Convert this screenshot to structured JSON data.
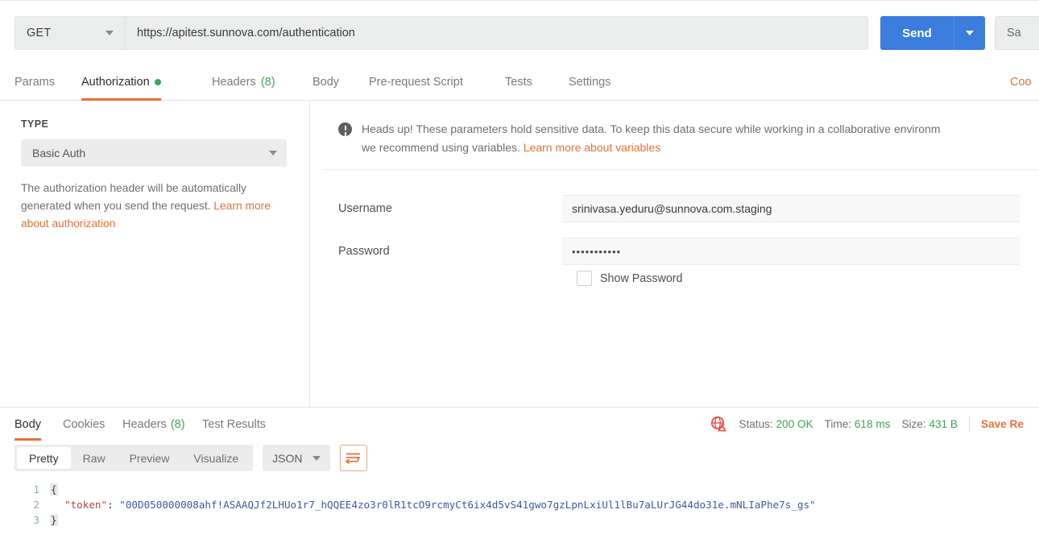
{
  "url_bar": {
    "method": "GET",
    "url": "https://apitest.sunnova.com/authentication",
    "send_label": "Send",
    "save_label": "Sa",
    "caret_icon": "chevron-down-icon"
  },
  "request_tabs": {
    "items": [
      {
        "label": "Params",
        "active": false,
        "badge": ""
      },
      {
        "label": "Authorization",
        "active": true,
        "badge": "",
        "dot": true
      },
      {
        "label": "Headers",
        "active": false,
        "badge": "(8)"
      },
      {
        "label": "Body",
        "active": false,
        "badge": ""
      },
      {
        "label": "Pre-request Script",
        "active": false,
        "badge": ""
      },
      {
        "label": "Tests",
        "active": false,
        "badge": ""
      },
      {
        "label": "Settings",
        "active": false,
        "badge": ""
      }
    ],
    "cookies_link": "Coo"
  },
  "auth": {
    "type_heading": "TYPE",
    "type_value": "Basic Auth",
    "help_text_1": "The authorization header will be automatically generated when you send the request. ",
    "help_link": "Learn more about authorization",
    "banner_line1": "Heads up! These parameters hold sensitive data. To keep this data secure while working in a collaborative environm",
    "banner_line2_text": "we recommend using variables. ",
    "banner_line2_link": "Learn more about variables",
    "username_label": "Username",
    "username_value": "srinivasa.yeduru@sunnova.com.staging",
    "password_label": "Password",
    "password_value": "•••••••••••",
    "show_password_label": "Show Password"
  },
  "response": {
    "tabs": [
      {
        "label": "Body",
        "active": true,
        "badge": ""
      },
      {
        "label": "Cookies",
        "active": false,
        "badge": ""
      },
      {
        "label": "Headers",
        "active": false,
        "badge": "(8)"
      },
      {
        "label": "Test Results",
        "active": false,
        "badge": ""
      }
    ],
    "status_label": "Status:",
    "status_value": "200 OK",
    "time_label": "Time:",
    "time_value": "618 ms",
    "size_label": "Size:",
    "size_value": "431 B",
    "save_response_label": "Save Re",
    "globe_icon": "globe-warning-icon",
    "format_tabs": [
      {
        "label": "Pretty",
        "active": true
      },
      {
        "label": "Raw",
        "active": false
      },
      {
        "label": "Preview",
        "active": false
      },
      {
        "label": "Visualize",
        "active": false
      }
    ],
    "language": "JSON",
    "wrap_icon": "word-wrap-icon",
    "body_lines": [
      {
        "num": "1",
        "open_brace": "{"
      },
      {
        "num": "2",
        "key": "\"token\"",
        "colon": ": ",
        "value": "\"00D050000008ahf!ASAAQJf2LHUo1r7_hQQEE4zo3r0lR1tcO9rcmyCt6ix4d5vS41gwo7gzLpnLxiUl1lBu7aLUrJG44do31e.mNLIaPhe7s_gs\""
      },
      {
        "num": "3",
        "close_brace": "}"
      }
    ]
  },
  "colors": {
    "accent_orange": "#e8703a",
    "send_blue": "#3b7ddd",
    "success_green": "#3aa757",
    "status_red": "#e8453c"
  }
}
